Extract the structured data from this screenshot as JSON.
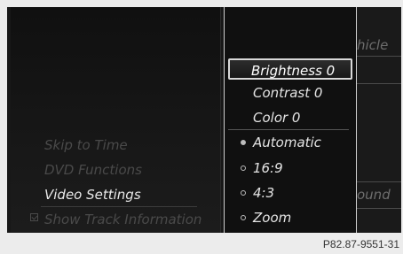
{
  "left_menu": {
    "items": [
      {
        "label": "Skip to Time",
        "active": false
      },
      {
        "label": "DVD Functions",
        "active": false
      },
      {
        "label": "Video Settings",
        "active": true
      },
      {
        "label": "Show Track Information",
        "active": false
      }
    ]
  },
  "dropdown": {
    "items": [
      {
        "label": "Brightness 0",
        "type": "value",
        "highlighted": true
      },
      {
        "label": "Contrast 0",
        "type": "value"
      },
      {
        "label": "Color 0",
        "type": "value"
      },
      {
        "label": "Automatic",
        "type": "radio",
        "selected": true
      },
      {
        "label": "16:9",
        "type": "radio",
        "selected": false
      },
      {
        "label": "4:3",
        "type": "radio",
        "selected": false
      },
      {
        "label": "Zoom",
        "type": "radio",
        "selected": false
      }
    ]
  },
  "right_panel": {
    "top_text": "hicle",
    "bottom_text": "ound"
  },
  "caption": "P82.87-9551-31",
  "colors": {
    "background": "#181818",
    "active_text": "#e8e8e8",
    "inactive_text": "#4a4a4a",
    "highlight_border": "#d8d8d8"
  }
}
